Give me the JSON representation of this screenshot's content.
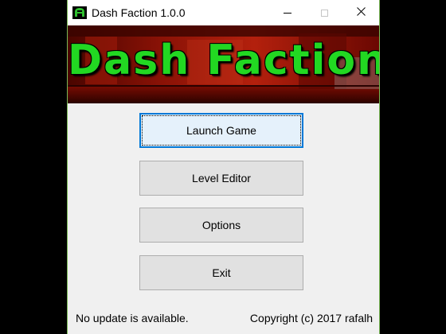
{
  "window": {
    "title": "Dash Faction 1.0.0"
  },
  "banner": {
    "logo_text": "Dash Faction",
    "logo_color": "#1fd61f"
  },
  "buttons": {
    "launch": "Launch Game",
    "editor": "Level Editor",
    "options": "Options",
    "exit": "Exit"
  },
  "footer": {
    "status": "No update is available.",
    "copyright": "Copyright (c) 2017 rafalh"
  },
  "colors": {
    "accent": "#0078d7",
    "window_border": "#7ab955",
    "banner_red": "#6d0a03"
  },
  "icons": {
    "app": "red-faction-helmet-icon",
    "minimize": "minimize-icon",
    "maximize": "maximize-icon",
    "close": "close-icon"
  }
}
